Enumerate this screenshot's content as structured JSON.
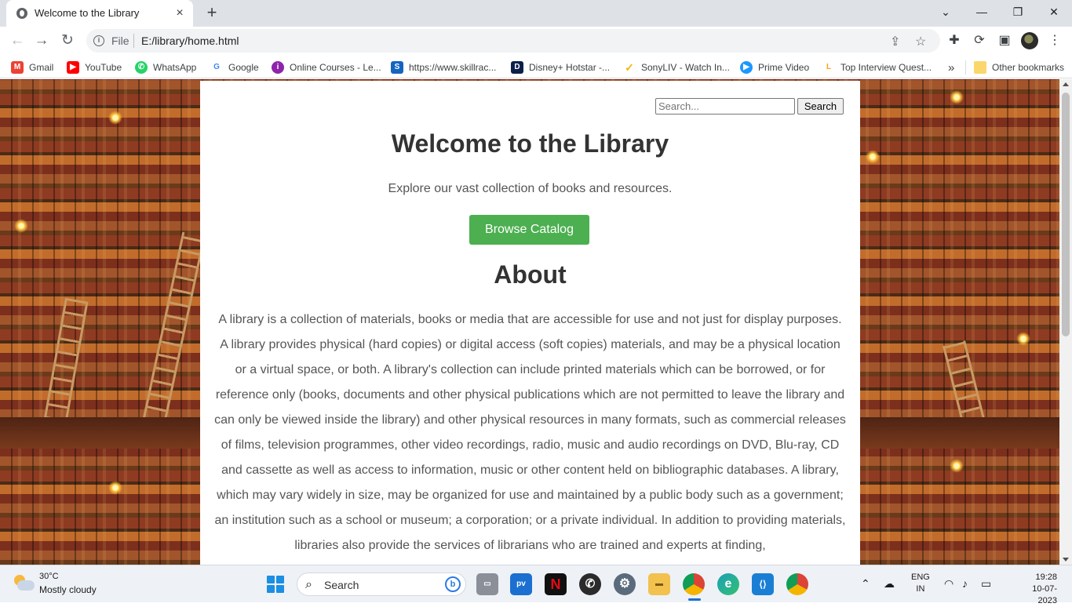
{
  "browser": {
    "tab_title": "Welcome to the Library",
    "new_tab_symbol": "+",
    "close_tab_symbol": "×",
    "window_controls": {
      "dropdown": "⌄",
      "minimize": "—",
      "maximize": "❐",
      "close": "✕"
    },
    "scheme_label": "File",
    "url": "E:/library/home.html",
    "bookmarks": [
      {
        "label": "Gmail",
        "icon": "gmail-icon",
        "color": "#ea4335",
        "glyph": "M"
      },
      {
        "label": "YouTube",
        "icon": "youtube-icon",
        "color": "#ff0000",
        "glyph": "▶"
      },
      {
        "label": "WhatsApp",
        "icon": "whatsapp-icon",
        "color": "#25d366",
        "glyph": "✆"
      },
      {
        "label": "Google",
        "icon": "google-icon",
        "color": "#4285f4",
        "glyph": "G"
      },
      {
        "label": "Online Courses - Le...",
        "icon": "courses-icon",
        "color": "#8e24aa",
        "glyph": "i"
      },
      {
        "label": "https://www.skillrac...",
        "icon": "skillrack-icon",
        "color": "#1565c0",
        "glyph": "S"
      },
      {
        "label": "Disney+ Hotstar -...",
        "icon": "hotstar-icon",
        "color": "#0c1f4a",
        "glyph": "D"
      },
      {
        "label": "SonyLIV - Watch In...",
        "icon": "sonyliv-icon",
        "color": "#f2b705",
        "glyph": "✓"
      },
      {
        "label": "Prime Video",
        "icon": "primevideo-icon",
        "color": "#1a98ff",
        "glyph": "▶"
      },
      {
        "label": "Top Interview Quest...",
        "icon": "leetcode-icon",
        "color": "#ffa116",
        "glyph": "L"
      }
    ],
    "more_bookmarks": "»",
    "other_bookmarks": "Other bookmarks"
  },
  "page": {
    "search_placeholder": "Search...",
    "search_button": "Search",
    "title": "Welcome to the Library",
    "subtitle": "Explore our vast collection of books and resources.",
    "browse_button": "Browse Catalog",
    "about_heading": "About",
    "about_text": "A library is a collection of materials, books or media that are accessible for use and not just for display purposes. A library provides physical (hard copies) or digital access (soft copies) materials, and may be a physical location or a virtual space, or both. A library's collection can include printed materials which can be borrowed, or for reference only (books, documents and other physical publications which are not permitted to leave the library and can only be viewed inside the library) and other physical resources in many formats, such as commercial releases of films, television programmes, other video recordings, radio, music and audio recordings on DVD, Blu-ray, CD and cassette as well as access to information, music or other content held on bibliographic databases. A library, which may vary widely in size, may be organized for use and maintained by a public body such as a government; an institution such as a school or museum; a corporation; or a private individual. In addition to providing materials, libraries also provide the services of librarians who are trained and experts at finding,"
  },
  "taskbar": {
    "temperature": "30°C",
    "condition": "Mostly cloudy",
    "search_label": "Search",
    "apps": [
      {
        "name": "task-view-icon",
        "color": "#8a8f98",
        "glyph": "▭"
      },
      {
        "name": "prime-video-app-icon",
        "color": "#1a6fd1",
        "glyph": "pv"
      },
      {
        "name": "netflix-app-icon",
        "color": "#111111",
        "glyph": "N"
      },
      {
        "name": "whatsapp-app-icon",
        "color": "#2b2b2b",
        "glyph": "✆"
      },
      {
        "name": "settings-app-icon",
        "color": "#5a6b7d",
        "glyph": "⚙"
      },
      {
        "name": "file-explorer-app-icon",
        "color": "#f2c14e",
        "glyph": "▬"
      },
      {
        "name": "chrome-app-icon",
        "color": "#db4437",
        "glyph": "◉"
      },
      {
        "name": "edge-app-icon",
        "color": "#1aa0b8",
        "glyph": "e"
      },
      {
        "name": "vscode-app-icon",
        "color": "#1a7fd4",
        "glyph": "⟨⟩"
      },
      {
        "name": "chrome-profile-app-icon",
        "color": "#0f9d58",
        "glyph": "◉"
      }
    ],
    "language_line1": "ENG",
    "language_line2": "IN",
    "time": "19:28",
    "date": "10-07-2023"
  }
}
